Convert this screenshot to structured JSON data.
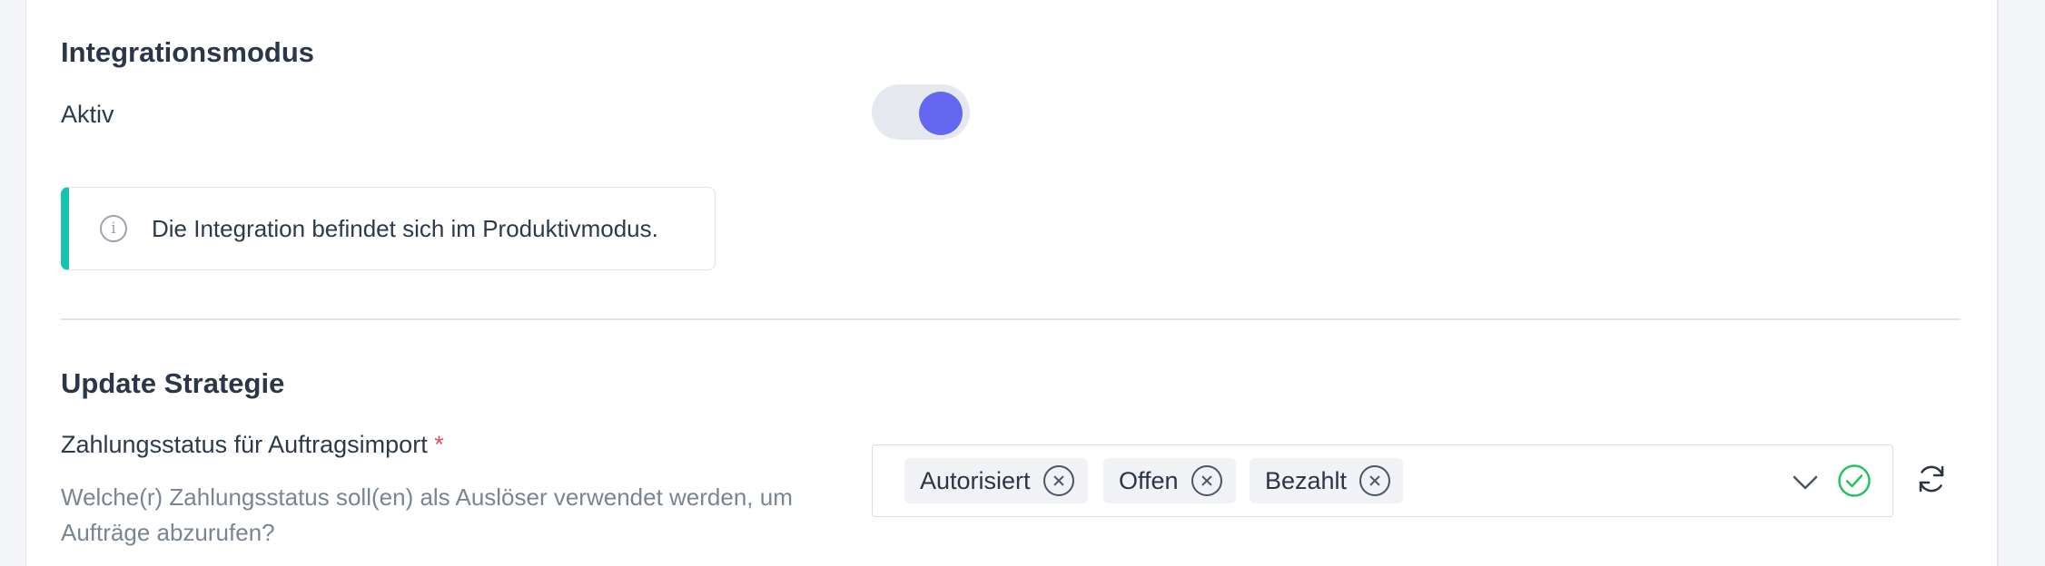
{
  "integration": {
    "title": "Integrationsmodus",
    "active_label": "Aktiv",
    "active_toggle_on": true,
    "notice_text": "Die Integration befindet sich im Produktivmodus.",
    "info_icon": "info-icon"
  },
  "update": {
    "title": "Update Strategie",
    "field_label": "Zahlungsstatus für Auftragsimport",
    "required_mark": "*",
    "description": "Welche(r) Zahlungsstatus soll(en) als Auslöser verwendet werden, um Aufträge abzurufen?",
    "selected": [
      "Autorisiert",
      "Offen",
      "Bezahlt"
    ],
    "icons": {
      "remove": "close-circle-icon",
      "dropdown": "chevron-down-icon",
      "valid": "check-circle-icon",
      "refresh": "refresh-icon"
    }
  },
  "colors": {
    "accent": "#6366f1",
    "notice_accent": "#17c3b2",
    "valid": "#22c55e",
    "required": "#e0505a"
  }
}
